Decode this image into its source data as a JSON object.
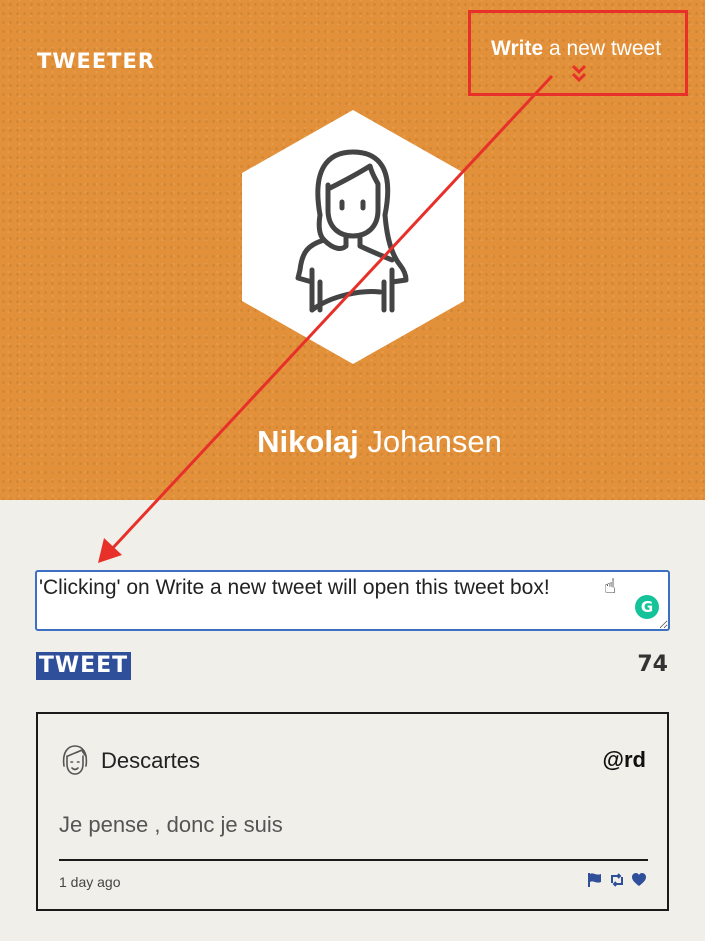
{
  "header": {
    "brand": "TWEETER",
    "write_link": {
      "strong": "Write",
      "rest": " a new tweet"
    },
    "profile": {
      "first_name": "Nikolaj",
      "last_name": " Johansen"
    }
  },
  "compose": {
    "text": "'Clicking' on Write a new tweet will open this tweet box!",
    "tweet_button_label": "TWEET",
    "char_count": "74",
    "hand_icon": "☝"
  },
  "feed": {
    "items": [
      {
        "name": "Descartes",
        "handle": "@rd",
        "text": "Je pense , donc je suis",
        "time": "1 day ago"
      }
    ]
  },
  "colors": {
    "header_bg": "#e2913a",
    "page_bg": "#f1efe9",
    "accent_blue": "#2f4f9a",
    "annotation_red": "#e8302a",
    "grammarly_green": "#15c39a"
  },
  "icons": [
    "chevron-double-down-icon",
    "avatar-icon",
    "hand-pointer-icon",
    "grammarly-icon",
    "flag-icon",
    "retweet-icon",
    "heart-icon"
  ]
}
